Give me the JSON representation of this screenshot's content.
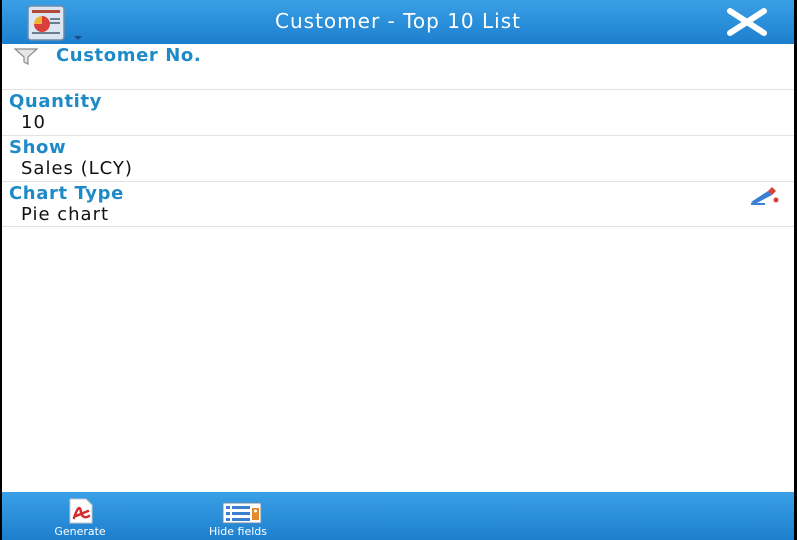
{
  "header": {
    "title": "Customer - Top 10 List"
  },
  "filter": {
    "label": "Customer No."
  },
  "fields": [
    {
      "label": "Quantity",
      "value": "10"
    },
    {
      "label": "Show",
      "value": "Sales (LCY)"
    },
    {
      "label": "Chart Type",
      "value": "Pie chart"
    }
  ],
  "footer": {
    "generate_label": "Generate",
    "hide_fields_label": "Hide fields"
  },
  "icons": {
    "app": "report-chart-icon",
    "close": "close-icon",
    "filter": "filter-funnel-icon",
    "edit": "edit-pencil-icon",
    "generate": "pdf-document-icon",
    "hide_fields": "field-list-icon"
  },
  "colors": {
    "header_blue": "#1c7fce",
    "label_blue": "#1e8ac7"
  }
}
